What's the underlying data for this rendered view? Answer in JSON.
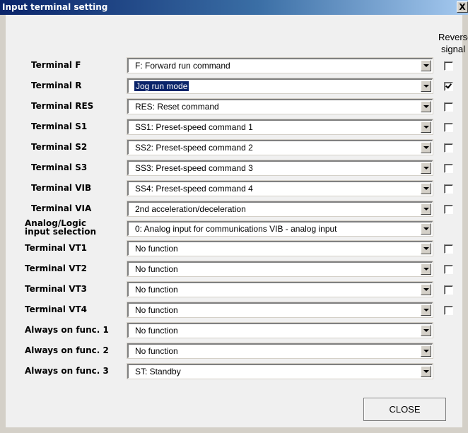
{
  "window": {
    "title": "Input terminal setting",
    "close_glyph": "X"
  },
  "reverse_header": {
    "line1": "Reverse",
    "line2": "signal"
  },
  "rows": [
    {
      "label": "Terminal F",
      "value": "F: Forward run command",
      "selected": false,
      "has_checkbox": true,
      "checked": false
    },
    {
      "label": "Terminal R",
      "value": "Jog run mode",
      "selected": true,
      "has_checkbox": true,
      "checked": true
    },
    {
      "label": "Terminal RES",
      "value": "RES: Reset command",
      "selected": false,
      "has_checkbox": true,
      "checked": false
    },
    {
      "label": "Terminal S1",
      "value": "SS1: Preset-speed command 1",
      "selected": false,
      "has_checkbox": true,
      "checked": false
    },
    {
      "label": "Terminal S2",
      "value": "SS2: Preset-speed command 2",
      "selected": false,
      "has_checkbox": true,
      "checked": false
    },
    {
      "label": "Terminal S3",
      "value": "SS3: Preset-speed command 3",
      "selected": false,
      "has_checkbox": true,
      "checked": false
    },
    {
      "label": "Terminal VIB",
      "value": "SS4: Preset-speed command 4",
      "selected": false,
      "has_checkbox": true,
      "checked": false
    },
    {
      "label": "Terminal VIA",
      "value": "2nd acceleration/deceleration",
      "selected": false,
      "has_checkbox": true,
      "checked": false
    },
    {
      "label_line1": "Analog/Logic",
      "label_line2": "input selection",
      "value": "0: Analog input for communications   VIB - analog input",
      "selected": false,
      "has_checkbox": false
    },
    {
      "label": "Terminal VT1",
      "value": "No function",
      "selected": false,
      "has_checkbox": true,
      "checked": false
    },
    {
      "label": "Terminal VT2",
      "value": "No function",
      "selected": false,
      "has_checkbox": true,
      "checked": false
    },
    {
      "label": "Terminal VT3",
      "value": "No function",
      "selected": false,
      "has_checkbox": true,
      "checked": false
    },
    {
      "label": "Terminal VT4",
      "value": "No function",
      "selected": false,
      "has_checkbox": true,
      "checked": false
    },
    {
      "label": "Always on func. 1",
      "value": "No function",
      "selected": false,
      "has_checkbox": false
    },
    {
      "label": "Always on func. 2",
      "value": "No function",
      "selected": false,
      "has_checkbox": false
    },
    {
      "label": "Always on func. 3",
      "value": "ST: Standby",
      "selected": false,
      "has_checkbox": false
    }
  ],
  "buttons": {
    "close_label": "CLOSE"
  }
}
